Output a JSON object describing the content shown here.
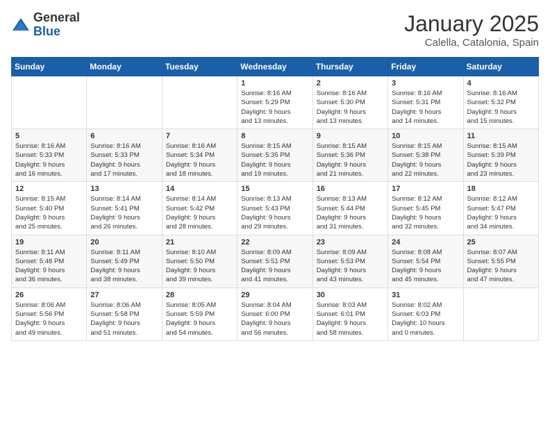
{
  "logo": {
    "general": "General",
    "blue": "Blue"
  },
  "title": "January 2025",
  "location": "Calella, Catalonia, Spain",
  "weekdays": [
    "Sunday",
    "Monday",
    "Tuesday",
    "Wednesday",
    "Thursday",
    "Friday",
    "Saturday"
  ],
  "weeks": [
    [
      {
        "day": "",
        "info": ""
      },
      {
        "day": "",
        "info": ""
      },
      {
        "day": "",
        "info": ""
      },
      {
        "day": "1",
        "info": "Sunrise: 8:16 AM\nSunset: 5:29 PM\nDaylight: 9 hours\nand 13 minutes."
      },
      {
        "day": "2",
        "info": "Sunrise: 8:16 AM\nSunset: 5:30 PM\nDaylight: 9 hours\nand 13 minutes."
      },
      {
        "day": "3",
        "info": "Sunrise: 8:16 AM\nSunset: 5:31 PM\nDaylight: 9 hours\nand 14 minutes."
      },
      {
        "day": "4",
        "info": "Sunrise: 8:16 AM\nSunset: 5:32 PM\nDaylight: 9 hours\nand 15 minutes."
      }
    ],
    [
      {
        "day": "5",
        "info": "Sunrise: 8:16 AM\nSunset: 5:33 PM\nDaylight: 9 hours\nand 16 minutes."
      },
      {
        "day": "6",
        "info": "Sunrise: 8:16 AM\nSunset: 5:33 PM\nDaylight: 9 hours\nand 17 minutes."
      },
      {
        "day": "7",
        "info": "Sunrise: 8:16 AM\nSunset: 5:34 PM\nDaylight: 9 hours\nand 18 minutes."
      },
      {
        "day": "8",
        "info": "Sunrise: 8:15 AM\nSunset: 5:35 PM\nDaylight: 9 hours\nand 19 minutes."
      },
      {
        "day": "9",
        "info": "Sunrise: 8:15 AM\nSunset: 5:36 PM\nDaylight: 9 hours\nand 21 minutes."
      },
      {
        "day": "10",
        "info": "Sunrise: 8:15 AM\nSunset: 5:38 PM\nDaylight: 9 hours\nand 22 minutes."
      },
      {
        "day": "11",
        "info": "Sunrise: 8:15 AM\nSunset: 5:39 PM\nDaylight: 9 hours\nand 23 minutes."
      }
    ],
    [
      {
        "day": "12",
        "info": "Sunrise: 8:15 AM\nSunset: 5:40 PM\nDaylight: 9 hours\nand 25 minutes."
      },
      {
        "day": "13",
        "info": "Sunrise: 8:14 AM\nSunset: 5:41 PM\nDaylight: 9 hours\nand 26 minutes."
      },
      {
        "day": "14",
        "info": "Sunrise: 8:14 AM\nSunset: 5:42 PM\nDaylight: 9 hours\nand 28 minutes."
      },
      {
        "day": "15",
        "info": "Sunrise: 8:13 AM\nSunset: 5:43 PM\nDaylight: 9 hours\nand 29 minutes."
      },
      {
        "day": "16",
        "info": "Sunrise: 8:13 AM\nSunset: 5:44 PM\nDaylight: 9 hours\nand 31 minutes."
      },
      {
        "day": "17",
        "info": "Sunrise: 8:12 AM\nSunset: 5:45 PM\nDaylight: 9 hours\nand 32 minutes."
      },
      {
        "day": "18",
        "info": "Sunrise: 8:12 AM\nSunset: 5:47 PM\nDaylight: 9 hours\nand 34 minutes."
      }
    ],
    [
      {
        "day": "19",
        "info": "Sunrise: 8:11 AM\nSunset: 5:48 PM\nDaylight: 9 hours\nand 36 minutes."
      },
      {
        "day": "20",
        "info": "Sunrise: 8:11 AM\nSunset: 5:49 PM\nDaylight: 9 hours\nand 38 minutes."
      },
      {
        "day": "21",
        "info": "Sunrise: 8:10 AM\nSunset: 5:50 PM\nDaylight: 9 hours\nand 39 minutes."
      },
      {
        "day": "22",
        "info": "Sunrise: 8:09 AM\nSunset: 5:51 PM\nDaylight: 9 hours\nand 41 minutes."
      },
      {
        "day": "23",
        "info": "Sunrise: 8:09 AM\nSunset: 5:53 PM\nDaylight: 9 hours\nand 43 minutes."
      },
      {
        "day": "24",
        "info": "Sunrise: 8:08 AM\nSunset: 5:54 PM\nDaylight: 9 hours\nand 45 minutes."
      },
      {
        "day": "25",
        "info": "Sunrise: 8:07 AM\nSunset: 5:55 PM\nDaylight: 9 hours\nand 47 minutes."
      }
    ],
    [
      {
        "day": "26",
        "info": "Sunrise: 8:06 AM\nSunset: 5:56 PM\nDaylight: 9 hours\nand 49 minutes."
      },
      {
        "day": "27",
        "info": "Sunrise: 8:06 AM\nSunset: 5:58 PM\nDaylight: 9 hours\nand 51 minutes."
      },
      {
        "day": "28",
        "info": "Sunrise: 8:05 AM\nSunset: 5:59 PM\nDaylight: 9 hours\nand 54 minutes."
      },
      {
        "day": "29",
        "info": "Sunrise: 8:04 AM\nSunset: 6:00 PM\nDaylight: 9 hours\nand 56 minutes."
      },
      {
        "day": "30",
        "info": "Sunrise: 8:03 AM\nSunset: 6:01 PM\nDaylight: 9 hours\nand 58 minutes."
      },
      {
        "day": "31",
        "info": "Sunrise: 8:02 AM\nSunset: 6:03 PM\nDaylight: 10 hours\nand 0 minutes."
      },
      {
        "day": "",
        "info": ""
      }
    ]
  ]
}
